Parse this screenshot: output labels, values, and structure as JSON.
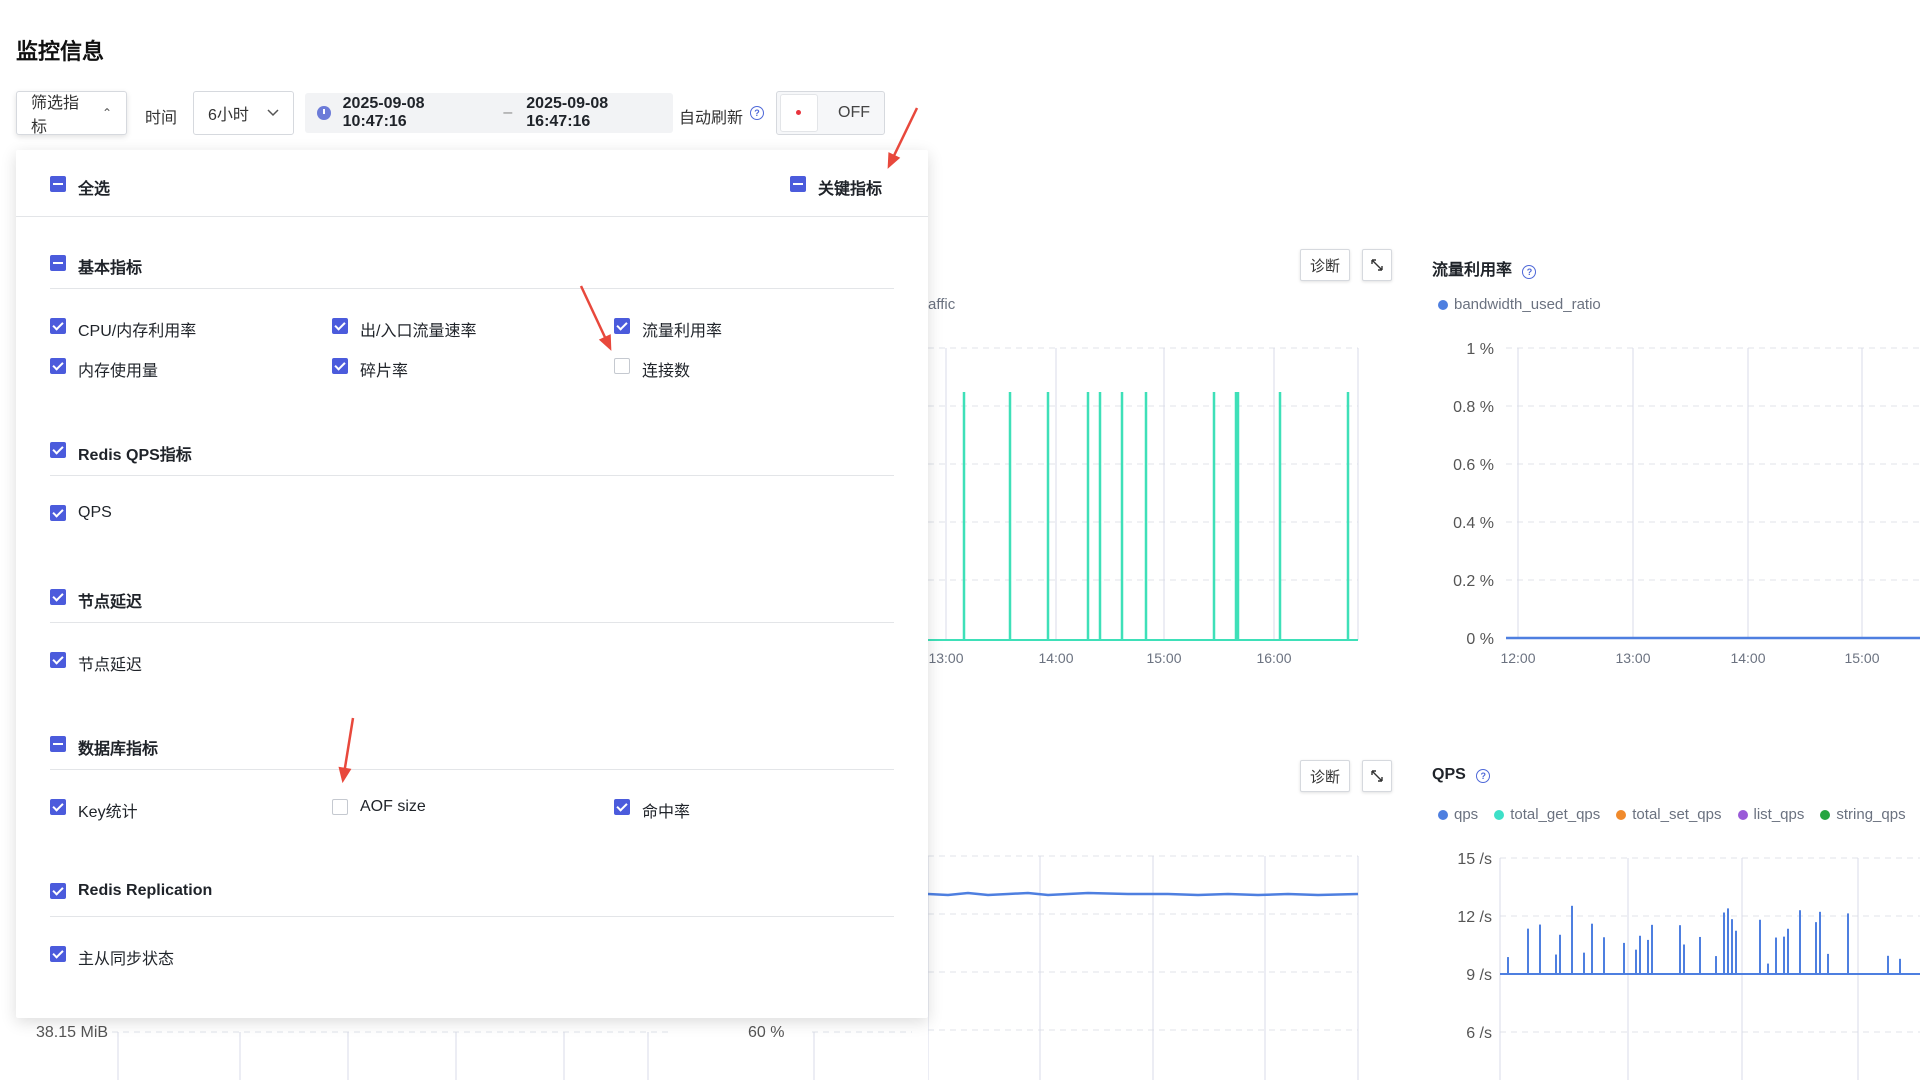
{
  "page": {
    "title": "监控信息"
  },
  "toolbar": {
    "filter_label": "筛选指标",
    "time_label": "时间",
    "range_value": "6小时",
    "start_time": "2025-09-08 10:47:16",
    "range_sep": "–",
    "end_time": "2025-09-08 16:47:16",
    "auto_refresh_label": "自动刷新",
    "switch_label": "OFF"
  },
  "filter_panel": {
    "select_all": "全选",
    "key_metrics": "关键指标",
    "groups": {
      "basic": {
        "title": "基本指标",
        "items": [
          "CPU/内存利用率",
          "出/入口流量速率",
          "流量利用率",
          "内存使用量",
          "碎片率",
          "连接数"
        ]
      },
      "qps": {
        "title": "Redis QPS指标",
        "items": [
          "QPS"
        ]
      },
      "latency": {
        "title": "节点延迟",
        "items": [
          "节点延迟"
        ]
      },
      "db": {
        "title": "数据库指标",
        "items": [
          "Key统计",
          "AOF size",
          "命中率"
        ]
      },
      "repl": {
        "title": "Redis Replication",
        "items": [
          "主从同步状态"
        ]
      }
    }
  },
  "charts": {
    "diag_label": "诊断",
    "traffic": {
      "legend_fragment": "affic",
      "x_ticks": [
        "13:00",
        "14:00",
        "15:00",
        "16:00"
      ],
      "color": "#3ee0b8"
    },
    "bandwidth": {
      "title": "流量利用率",
      "legend": "bandwidth_used_ratio",
      "color": "#4e7fe0",
      "y_ticks": [
        "1 %",
        "0.8 %",
        "0.6 %",
        "0.4 %",
        "0.2 %",
        "0 %"
      ],
      "x_ticks": [
        "12:00",
        "13:00",
        "14:00",
        "15:00"
      ]
    },
    "qps": {
      "title": "QPS",
      "legend": [
        {
          "name": "qps",
          "color": "#4e7fe0"
        },
        {
          "name": "total_get_qps",
          "color": "#3ee0c8"
        },
        {
          "name": "total_set_qps",
          "color": "#f08a2c"
        },
        {
          "name": "list_qps",
          "color": "#9a5ad8"
        },
        {
          "name": "string_qps",
          "color": "#26a53f"
        }
      ],
      "y_ticks": [
        "15 /s",
        "12 /s",
        "9 /s",
        "6 /s"
      ]
    },
    "bottom_left_value": "38.15 MiB",
    "bottom_mid_value": "60 %"
  },
  "annotation_color": "#e8483c"
}
